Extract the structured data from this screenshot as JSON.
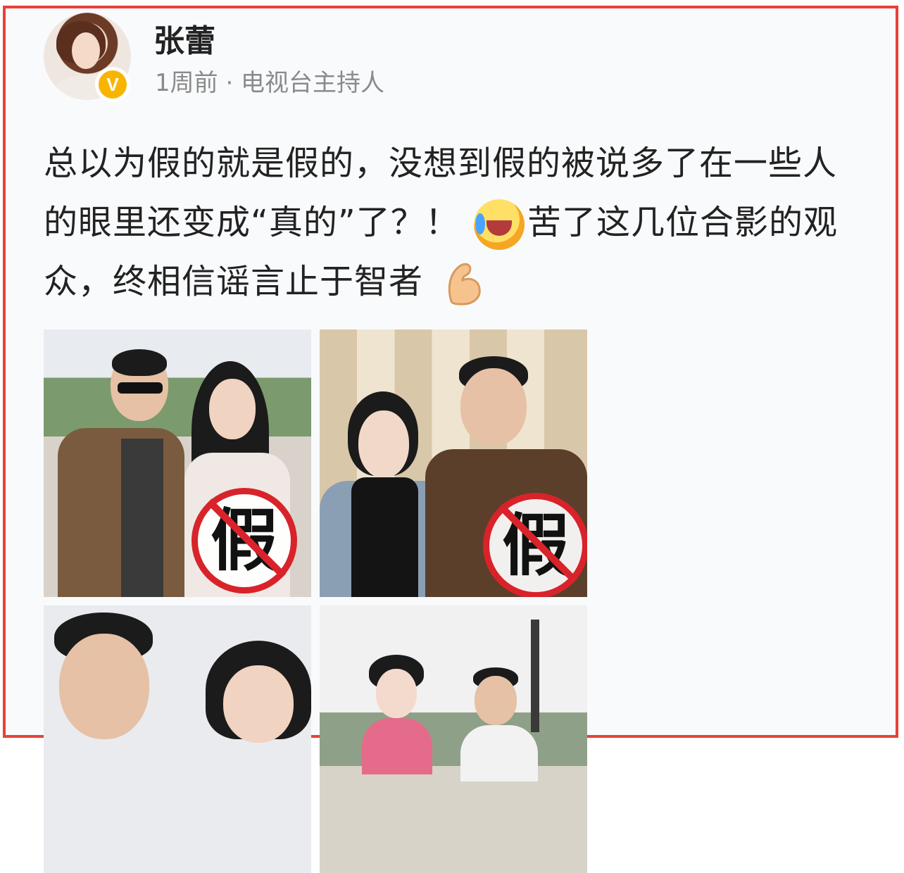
{
  "post": {
    "username": "张蕾",
    "meta": "1周前 · 电视台主持人",
    "verified_badge": "V",
    "text_part1": "总以为假的就是假的，没想到假的被说多了在一些人的眼里还变成“真的”了？！",
    "text_part2": "苦了这几位合影的观众，终相信谣言止于智者",
    "emoji_1": "laughing-crying-emoji",
    "emoji_2": "flexed-biceps-emoji"
  },
  "photos": [
    {
      "stamp": "假"
    },
    {
      "stamp": "假"
    },
    {
      "stamp": ""
    },
    {
      "stamp": ""
    }
  ],
  "colors": {
    "frame_border": "#e8413a",
    "stamp_red": "#d8232a",
    "badge_gold": "#f7b500"
  }
}
